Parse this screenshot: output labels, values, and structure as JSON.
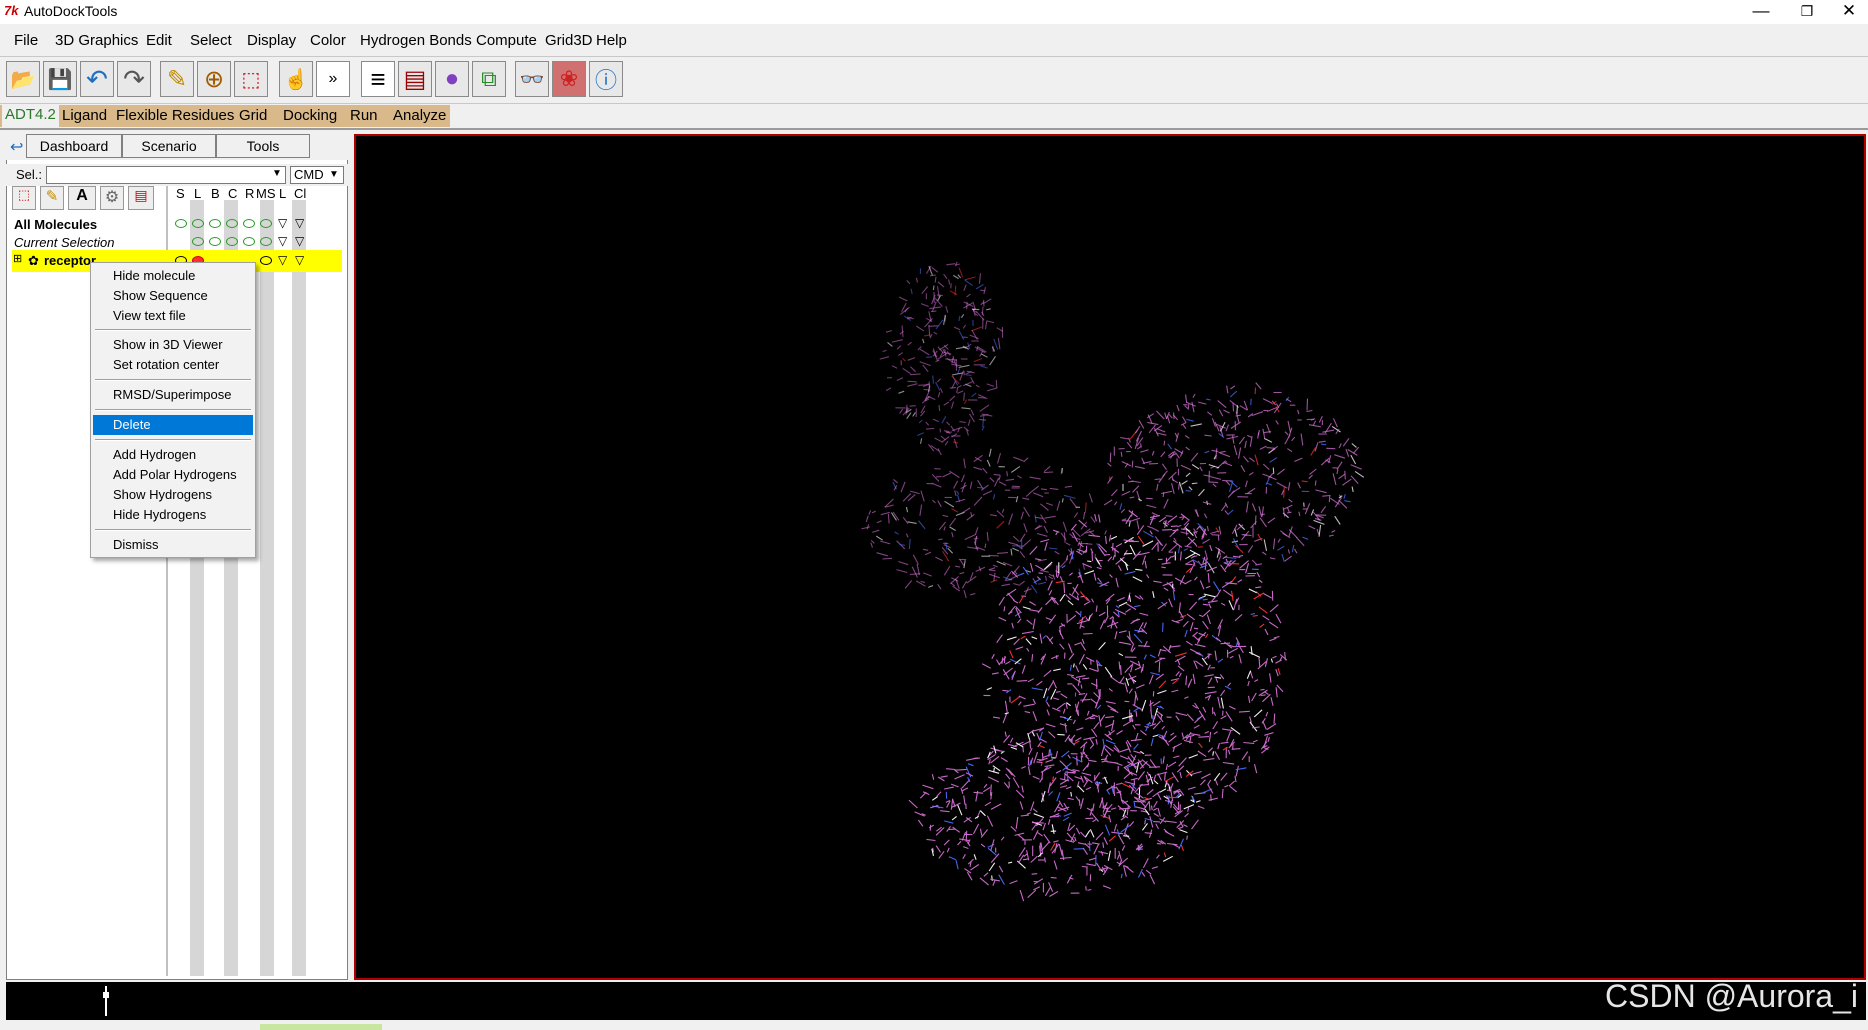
{
  "window": {
    "title": "AutoDockTools",
    "icon_text": "7k",
    "controls": [
      "—",
      "❐",
      "✕"
    ]
  },
  "menubar": [
    "File",
    "3D Graphics",
    "Edit",
    "Select",
    "Display",
    "Color",
    "Hydrogen Bonds",
    "Compute",
    "Grid3D",
    "Help"
  ],
  "toolbar": {
    "icons": [
      "open-folder-icon",
      "save-icon",
      "undo-icon",
      "redo-icon",
      "pencil-icon",
      "center-target-icon",
      "selection-icon",
      "hand-pointer-icon",
      "python-shell-icon",
      "text-align-icon",
      "display-panel-icon",
      "color-sphere-icon",
      "tree-icon",
      "stereo-glasses-icon",
      "spline-icon",
      "info-icon"
    ],
    "glyphs": [
      "📂",
      "💾",
      "↶",
      "↷",
      "✎",
      "⊕",
      "⬚",
      "☝",
      "»",
      "≡",
      "▤",
      "●",
      "⧉",
      "👓",
      "❀",
      "ⓘ"
    ]
  },
  "modtabs": [
    "ADT4.2",
    "Ligand",
    "Flexible Residues",
    "Grid",
    "Docking",
    "Run",
    "Analyze"
  ],
  "panel": {
    "back_glyph": "↩",
    "tabs": [
      "Dashboard",
      "Scenario",
      "Tools"
    ],
    "sel_label": "Sel.:",
    "sel_value": "",
    "cmd_label": "CMD",
    "dropdown_glyph": "▼",
    "columns": [
      "S",
      "L",
      "B",
      "C",
      "R",
      "MS",
      "L",
      "Cl"
    ],
    "rows": [
      {
        "label": "All Molecules"
      },
      {
        "label": "Current Selection"
      },
      {
        "label": "receptor",
        "expander": "⊞"
      }
    ],
    "tri_glyph": "▽"
  },
  "context_menu": {
    "groups": [
      [
        "Hide molecule",
        "Show Sequence",
        "View text file"
      ],
      [
        "Show in 3D Viewer",
        "Set rotation center"
      ],
      [
        "RMSD/Superimpose"
      ],
      [
        "Delete"
      ],
      [
        "Add Hydrogen",
        "Add Polar Hydrogens",
        "Show Hydrogens",
        "Hide Hydrogens"
      ],
      [
        "Dismiss"
      ]
    ],
    "highlighted": "Delete"
  },
  "watermark": "CSDN @Aurora_i",
  "colors": {
    "accent_blue": "#0078d7",
    "selected_row": "#ffff00",
    "viewer_border": "#b00000",
    "molecule": "#d36fd3"
  }
}
